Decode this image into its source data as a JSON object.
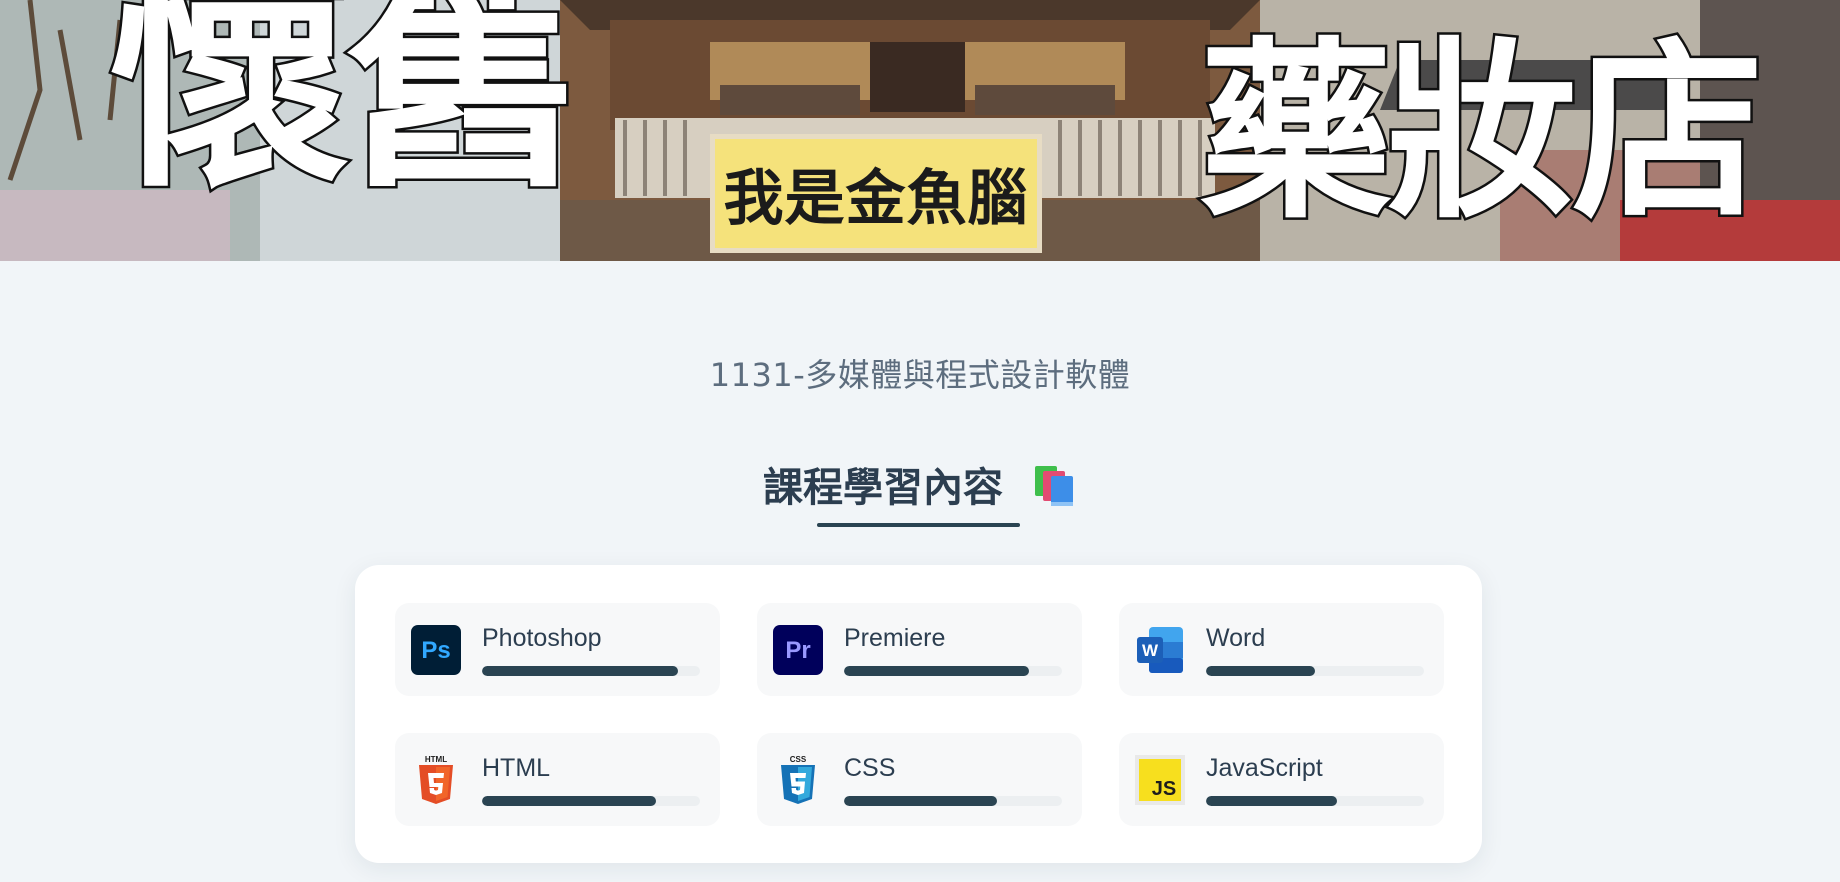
{
  "hero": {
    "left_text": "懷舊",
    "right_text": "藥妝店",
    "sign_text": "我是金魚腦"
  },
  "subtitle": "1131-多媒體與程式設計軟體",
  "section": {
    "title": "課程學習內容",
    "title_icon": "books-icon"
  },
  "skills": [
    {
      "name": "Photoshop",
      "icon": "photoshop-icon",
      "progress": 0.9
    },
    {
      "name": "Premiere",
      "icon": "premiere-icon",
      "progress": 0.85
    },
    {
      "name": "Word",
      "icon": "word-icon",
      "progress": 0.5
    },
    {
      "name": "HTML",
      "icon": "html5-icon",
      "progress": 0.8
    },
    {
      "name": "CSS",
      "icon": "css3-icon",
      "progress": 0.7
    },
    {
      "name": "JavaScript",
      "icon": "javascript-icon",
      "progress": 0.6
    }
  ],
  "icon_labels": {
    "html": "HTML",
    "css": "CSS",
    "js": "JS",
    "ps": "Ps",
    "pr": "Pr",
    "w": "W"
  },
  "colors": {
    "page_bg": "#f1f5f8",
    "bar_fill": "#2a4452",
    "bar_track": "#eceff1",
    "title_text": "#2c3e50",
    "sign_bg": "#f5e27b"
  }
}
